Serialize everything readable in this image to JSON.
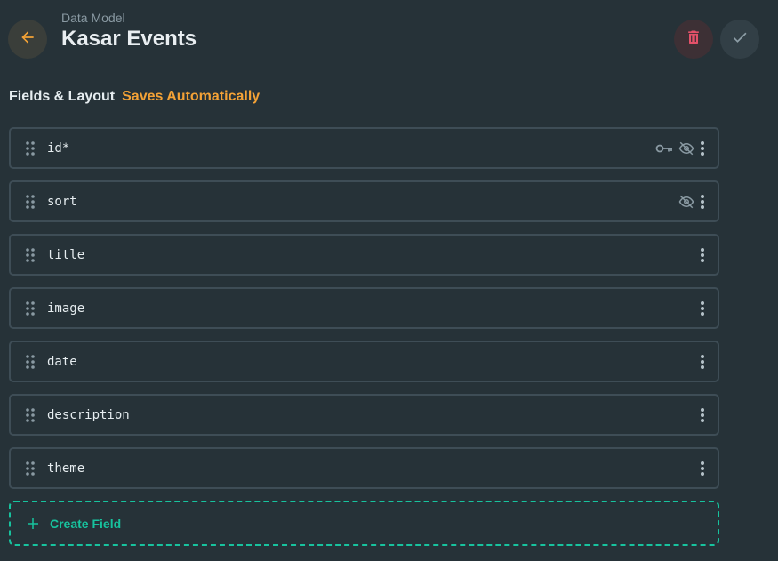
{
  "header": {
    "eyebrow": "Data Model",
    "title": "Kasar Events"
  },
  "section": {
    "label": "Fields & Layout",
    "status": "Saves Automatically"
  },
  "fields": [
    {
      "name": "id*",
      "icons": [
        "key-icon",
        "eye-off-icon",
        "more-vertical-icon"
      ]
    },
    {
      "name": "sort",
      "icons": [
        "eye-off-icon",
        "more-vertical-icon"
      ]
    },
    {
      "name": "title",
      "icons": [
        "more-vertical-icon"
      ]
    },
    {
      "name": "image",
      "icons": [
        "more-vertical-icon"
      ]
    },
    {
      "name": "date",
      "icons": [
        "more-vertical-icon"
      ]
    },
    {
      "name": "description",
      "icons": [
        "more-vertical-icon"
      ]
    },
    {
      "name": "theme",
      "icons": [
        "more-vertical-icon"
      ]
    }
  ],
  "create_field": {
    "label": "Create Field"
  },
  "colors": {
    "background": "#263238",
    "accent_orange": "#f4a236",
    "danger": "#e35169",
    "success": "#17c39e",
    "border": "#3e4d56"
  }
}
